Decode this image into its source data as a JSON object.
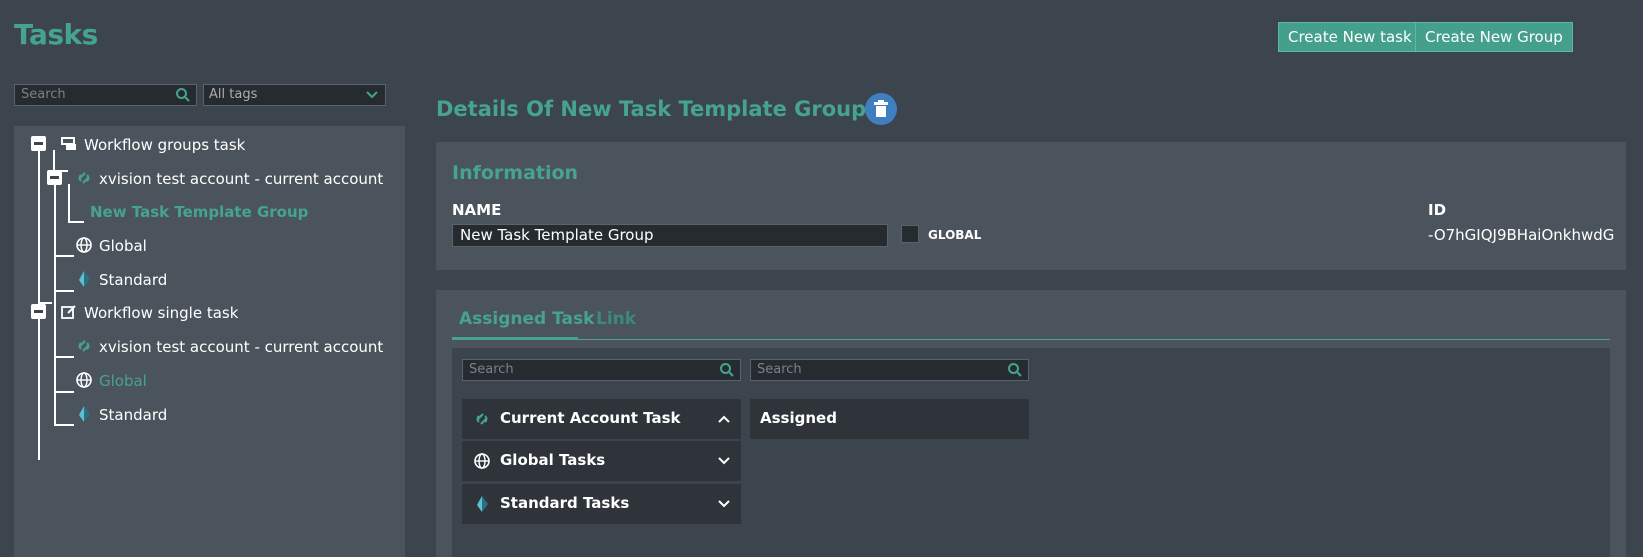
{
  "page": {
    "title": "Tasks"
  },
  "header": {
    "create_task_label": "Create New task",
    "create_group_label": "Create New Group"
  },
  "filters": {
    "search_placeholder": "Search",
    "tags_selected": "All tags"
  },
  "tree": {
    "group_root": {
      "label": "Workflow groups task",
      "children": [
        {
          "label": "xvision test account - current account"
        },
        {
          "label": "New Task Template Group"
        },
        {
          "label": "Global"
        },
        {
          "label": "Standard"
        }
      ]
    },
    "single_root": {
      "label": "Workflow single task",
      "children": [
        {
          "label": "xvision test account - current account"
        },
        {
          "label": "Global"
        },
        {
          "label": "Standard"
        }
      ]
    }
  },
  "details": {
    "heading": "Details Of New Task Template Group",
    "information_title": "Information",
    "name_label": "NAME",
    "name_value": "New Task Template Group",
    "global_label": "GLOBAL",
    "id_label": "ID",
    "id_value": "-O7hGIQJ9BHaiOnkhwdG"
  },
  "tabs": [
    {
      "label": "Assigned Task",
      "active": true
    },
    {
      "label": "Link",
      "active": false
    }
  ],
  "assign": {
    "left_search_placeholder": "Search",
    "right_search_placeholder": "Search",
    "sections": [
      {
        "label": "Current Account Task",
        "icon": "account-link-icon",
        "expanded": true
      },
      {
        "label": "Global Tasks",
        "icon": "globe-icon",
        "expanded": false
      },
      {
        "label": "Standard Tasks",
        "icon": "standard-logo-icon",
        "expanded": false
      }
    ],
    "assigned_header": "Assigned"
  },
  "colors": {
    "accent": "#46a38e",
    "background": "#3c444d",
    "panel": "#4b545c",
    "delete": "#3f7ebf"
  }
}
